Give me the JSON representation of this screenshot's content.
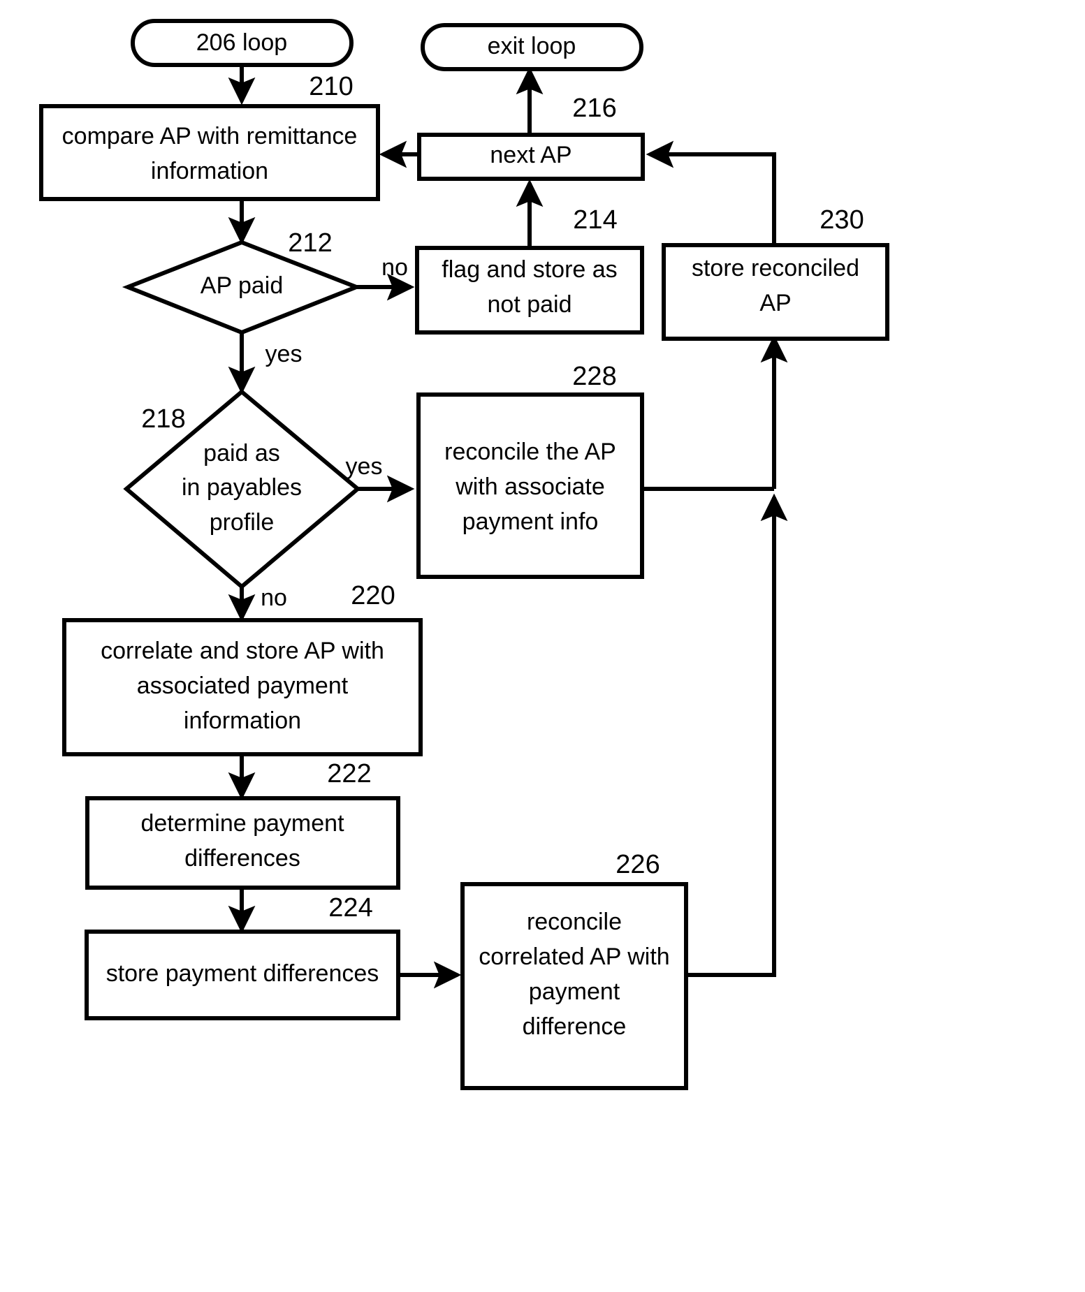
{
  "diagram": {
    "title": "AP reconciliation loop flowchart",
    "nodes": {
      "loop_start": {
        "label": "206 loop",
        "shape": "terminator"
      },
      "exit_loop": {
        "label": "exit loop",
        "shape": "terminator"
      },
      "n210": {
        "ref": "210",
        "line1": "compare AP with remittance",
        "line2": "information",
        "shape": "process"
      },
      "n216": {
        "ref": "216",
        "line1": "next AP",
        "shape": "process"
      },
      "n212": {
        "ref": "212",
        "line1": "AP paid",
        "shape": "decision"
      },
      "n214": {
        "ref": "214",
        "line1": "flag and store as",
        "line2": "not paid",
        "shape": "process"
      },
      "n230": {
        "ref": "230",
        "line1": "store reconciled",
        "line2": "AP",
        "shape": "process"
      },
      "n218": {
        "ref": "218",
        "line1": "paid as",
        "line2": "in payables",
        "line3": "profile",
        "shape": "decision"
      },
      "n228": {
        "ref": "228",
        "line1": "reconcile the AP",
        "line2": "with associate",
        "line3": "payment info",
        "shape": "process"
      },
      "n220": {
        "ref": "220",
        "line1": "correlate and store AP with",
        "line2": "associated payment",
        "line3": "information",
        "shape": "process"
      },
      "n222": {
        "ref": "222",
        "line1": "determine payment",
        "line2": "differences",
        "shape": "process"
      },
      "n224": {
        "ref": "224",
        "line1": "store payment differences",
        "shape": "process"
      },
      "n226": {
        "ref": "226",
        "line1": "reconcile",
        "line2": "correlated AP with",
        "line3": "payment",
        "line4": "difference",
        "shape": "process"
      }
    },
    "edge_labels": {
      "ap_paid_no": "no",
      "ap_paid_yes": "yes",
      "payables_yes": "yes",
      "payables_no": "no"
    },
    "colors": {
      "stroke": "#000000",
      "fill": "#ffffff",
      "background": "#ffffff"
    }
  }
}
